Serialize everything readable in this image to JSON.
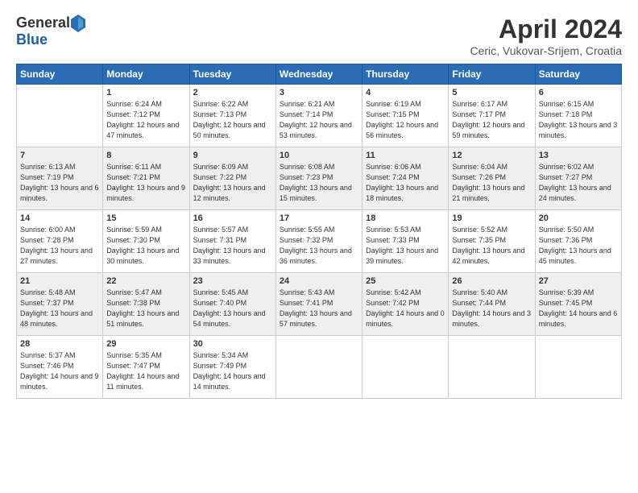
{
  "header": {
    "logo_general": "General",
    "logo_blue": "Blue",
    "month_title": "April 2024",
    "location": "Ceric, Vukovar-Srijem, Croatia"
  },
  "days_of_week": [
    "Sunday",
    "Monday",
    "Tuesday",
    "Wednesday",
    "Thursday",
    "Friday",
    "Saturday"
  ],
  "weeks": [
    [
      {
        "num": "",
        "sunrise": "",
        "sunset": "",
        "daylight": ""
      },
      {
        "num": "1",
        "sunrise": "Sunrise: 6:24 AM",
        "sunset": "Sunset: 7:12 PM",
        "daylight": "Daylight: 12 hours and 47 minutes."
      },
      {
        "num": "2",
        "sunrise": "Sunrise: 6:22 AM",
        "sunset": "Sunset: 7:13 PM",
        "daylight": "Daylight: 12 hours and 50 minutes."
      },
      {
        "num": "3",
        "sunrise": "Sunrise: 6:21 AM",
        "sunset": "Sunset: 7:14 PM",
        "daylight": "Daylight: 12 hours and 53 minutes."
      },
      {
        "num": "4",
        "sunrise": "Sunrise: 6:19 AM",
        "sunset": "Sunset: 7:15 PM",
        "daylight": "Daylight: 12 hours and 56 minutes."
      },
      {
        "num": "5",
        "sunrise": "Sunrise: 6:17 AM",
        "sunset": "Sunset: 7:17 PM",
        "daylight": "Daylight: 12 hours and 59 minutes."
      },
      {
        "num": "6",
        "sunrise": "Sunrise: 6:15 AM",
        "sunset": "Sunset: 7:18 PM",
        "daylight": "Daylight: 13 hours and 3 minutes."
      }
    ],
    [
      {
        "num": "7",
        "sunrise": "Sunrise: 6:13 AM",
        "sunset": "Sunset: 7:19 PM",
        "daylight": "Daylight: 13 hours and 6 minutes."
      },
      {
        "num": "8",
        "sunrise": "Sunrise: 6:11 AM",
        "sunset": "Sunset: 7:21 PM",
        "daylight": "Daylight: 13 hours and 9 minutes."
      },
      {
        "num": "9",
        "sunrise": "Sunrise: 6:09 AM",
        "sunset": "Sunset: 7:22 PM",
        "daylight": "Daylight: 13 hours and 12 minutes."
      },
      {
        "num": "10",
        "sunrise": "Sunrise: 6:08 AM",
        "sunset": "Sunset: 7:23 PM",
        "daylight": "Daylight: 13 hours and 15 minutes."
      },
      {
        "num": "11",
        "sunrise": "Sunrise: 6:06 AM",
        "sunset": "Sunset: 7:24 PM",
        "daylight": "Daylight: 13 hours and 18 minutes."
      },
      {
        "num": "12",
        "sunrise": "Sunrise: 6:04 AM",
        "sunset": "Sunset: 7:26 PM",
        "daylight": "Daylight: 13 hours and 21 minutes."
      },
      {
        "num": "13",
        "sunrise": "Sunrise: 6:02 AM",
        "sunset": "Sunset: 7:27 PM",
        "daylight": "Daylight: 13 hours and 24 minutes."
      }
    ],
    [
      {
        "num": "14",
        "sunrise": "Sunrise: 6:00 AM",
        "sunset": "Sunset: 7:28 PM",
        "daylight": "Daylight: 13 hours and 27 minutes."
      },
      {
        "num": "15",
        "sunrise": "Sunrise: 5:59 AM",
        "sunset": "Sunset: 7:30 PM",
        "daylight": "Daylight: 13 hours and 30 minutes."
      },
      {
        "num": "16",
        "sunrise": "Sunrise: 5:57 AM",
        "sunset": "Sunset: 7:31 PM",
        "daylight": "Daylight: 13 hours and 33 minutes."
      },
      {
        "num": "17",
        "sunrise": "Sunrise: 5:55 AM",
        "sunset": "Sunset: 7:32 PM",
        "daylight": "Daylight: 13 hours and 36 minutes."
      },
      {
        "num": "18",
        "sunrise": "Sunrise: 5:53 AM",
        "sunset": "Sunset: 7:33 PM",
        "daylight": "Daylight: 13 hours and 39 minutes."
      },
      {
        "num": "19",
        "sunrise": "Sunrise: 5:52 AM",
        "sunset": "Sunset: 7:35 PM",
        "daylight": "Daylight: 13 hours and 42 minutes."
      },
      {
        "num": "20",
        "sunrise": "Sunrise: 5:50 AM",
        "sunset": "Sunset: 7:36 PM",
        "daylight": "Daylight: 13 hours and 45 minutes."
      }
    ],
    [
      {
        "num": "21",
        "sunrise": "Sunrise: 5:48 AM",
        "sunset": "Sunset: 7:37 PM",
        "daylight": "Daylight: 13 hours and 48 minutes."
      },
      {
        "num": "22",
        "sunrise": "Sunrise: 5:47 AM",
        "sunset": "Sunset: 7:38 PM",
        "daylight": "Daylight: 13 hours and 51 minutes."
      },
      {
        "num": "23",
        "sunrise": "Sunrise: 5:45 AM",
        "sunset": "Sunset: 7:40 PM",
        "daylight": "Daylight: 13 hours and 54 minutes."
      },
      {
        "num": "24",
        "sunrise": "Sunrise: 5:43 AM",
        "sunset": "Sunset: 7:41 PM",
        "daylight": "Daylight: 13 hours and 57 minutes."
      },
      {
        "num": "25",
        "sunrise": "Sunrise: 5:42 AM",
        "sunset": "Sunset: 7:42 PM",
        "daylight": "Daylight: 14 hours and 0 minutes."
      },
      {
        "num": "26",
        "sunrise": "Sunrise: 5:40 AM",
        "sunset": "Sunset: 7:44 PM",
        "daylight": "Daylight: 14 hours and 3 minutes."
      },
      {
        "num": "27",
        "sunrise": "Sunrise: 5:39 AM",
        "sunset": "Sunset: 7:45 PM",
        "daylight": "Daylight: 14 hours and 6 minutes."
      }
    ],
    [
      {
        "num": "28",
        "sunrise": "Sunrise: 5:37 AM",
        "sunset": "Sunset: 7:46 PM",
        "daylight": "Daylight: 14 hours and 9 minutes."
      },
      {
        "num": "29",
        "sunrise": "Sunrise: 5:35 AM",
        "sunset": "Sunset: 7:47 PM",
        "daylight": "Daylight: 14 hours and 11 minutes."
      },
      {
        "num": "30",
        "sunrise": "Sunrise: 5:34 AM",
        "sunset": "Sunset: 7:49 PM",
        "daylight": "Daylight: 14 hours and 14 minutes."
      },
      {
        "num": "",
        "sunrise": "",
        "sunset": "",
        "daylight": ""
      },
      {
        "num": "",
        "sunrise": "",
        "sunset": "",
        "daylight": ""
      },
      {
        "num": "",
        "sunrise": "",
        "sunset": "",
        "daylight": ""
      },
      {
        "num": "",
        "sunrise": "",
        "sunset": "",
        "daylight": ""
      }
    ]
  ]
}
